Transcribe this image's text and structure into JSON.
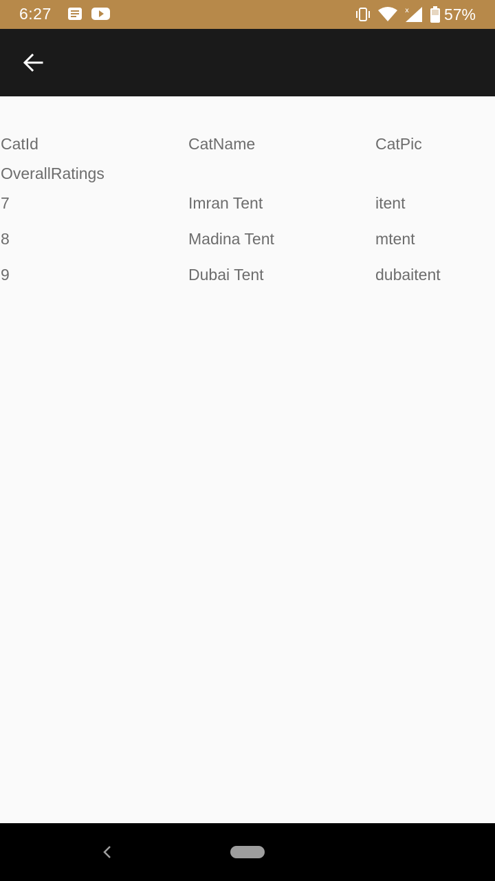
{
  "status_bar": {
    "time": "6:27",
    "battery_percent": "57%",
    "icons": [
      "message-icon",
      "youtube-icon",
      "vibrate-icon",
      "wifi-icon",
      "signal-icon",
      "battery-icon"
    ]
  },
  "app_bar": {
    "back_icon": "arrow-left-icon"
  },
  "table": {
    "headers": [
      "CatId",
      "CatName",
      "CatPic",
      "OverallRatings"
    ],
    "rows": [
      [
        "7",
        "Imran Tent",
        "itent"
      ],
      [
        "8",
        "Madina Tent",
        "mtent"
      ],
      [
        "9",
        "Dubai Tent",
        "dubaitent"
      ]
    ]
  },
  "nav_bar": {
    "back_icon": "chevron-left-icon",
    "home_icon": "home-pill-icon"
  },
  "colors": {
    "status_bar": "#b7894a",
    "app_bar": "#1a1a1a",
    "background": "#fafafa",
    "text": "#6d6d6d"
  }
}
